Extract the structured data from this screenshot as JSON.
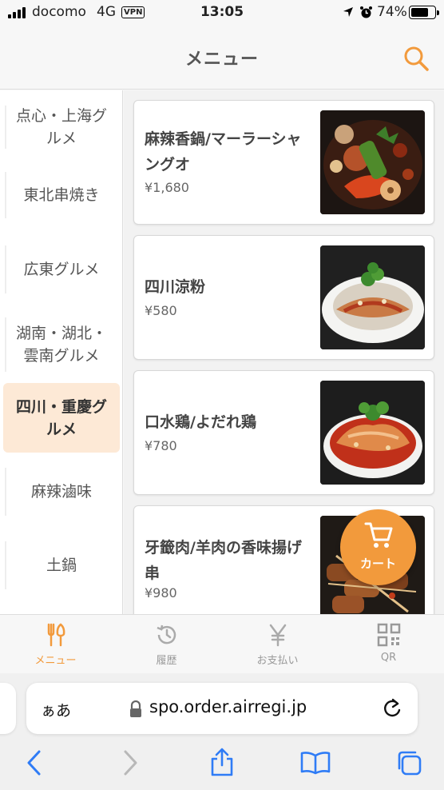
{
  "status_bar": {
    "carrier": "docomo",
    "network": "4G",
    "vpn": "VPN",
    "time": "13:05",
    "battery": "74%",
    "battery_level": 0.74
  },
  "header": {
    "title": "メニュー",
    "search_icon": "search-icon"
  },
  "categories": [
    {
      "label": "点心・上海グルメ",
      "active": false
    },
    {
      "label": "東北串焼き",
      "active": false
    },
    {
      "label": "広東グルメ",
      "active": false
    },
    {
      "label": "湖南・湖北・雲南グルメ",
      "active": false
    },
    {
      "label": "四川・重慶グルメ",
      "active": true
    },
    {
      "label": "麻辣滷味",
      "active": false
    },
    {
      "label": "土鍋",
      "active": false
    }
  ],
  "items": [
    {
      "name": "麻辣香鍋/マーラーシャングオ",
      "price": "¥1,680"
    },
    {
      "name": "四川涼粉",
      "price": "¥580"
    },
    {
      "name": "口水鶏/よだれ鶏",
      "price": "¥780"
    },
    {
      "name": "牙籤肉/羊肉の香味揚げ串",
      "price": "¥980"
    }
  ],
  "cart": {
    "label": "カート",
    "icon": "cart-icon"
  },
  "tabs": [
    {
      "label": "メニュー",
      "icon": "fork-knife-icon",
      "active": true
    },
    {
      "label": "履歴",
      "icon": "history-icon",
      "active": false
    },
    {
      "label": "お支払い",
      "icon": "yen-icon",
      "active": false
    },
    {
      "label": "QR",
      "icon": "qr-code-icon",
      "active": false
    }
  ],
  "browser": {
    "text_size_label": "ぁあ",
    "url": "spo.order.airregi.jp"
  },
  "colors": {
    "accent": "#f29a3c",
    "active_category_bg": "#fde9d6"
  }
}
